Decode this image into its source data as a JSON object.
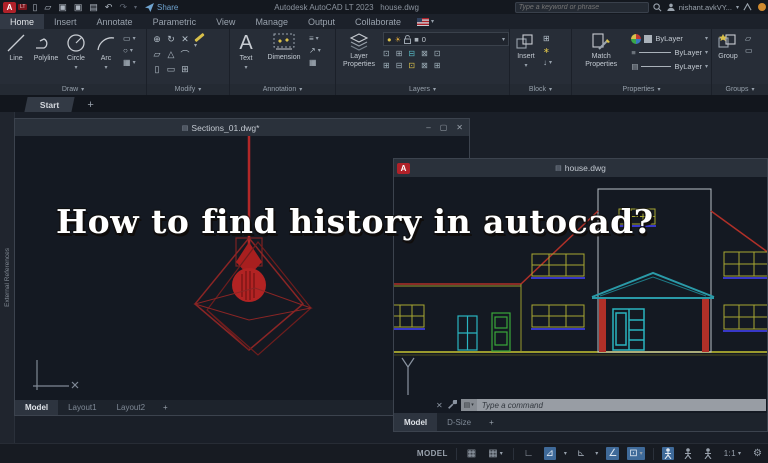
{
  "titlebar": {
    "logo_letter": "A",
    "logo_badge": "LT",
    "share_label": "Share",
    "app_title": "Autodesk AutoCAD LT 2023",
    "doc_name": "house.dwg",
    "search_placeholder": "Type a keyword or phrase",
    "account_name": "nishant.avkVY..."
  },
  "icons": {
    "new": "▯",
    "open": "▱",
    "save": "▣",
    "save_as": "▣",
    "plot": "▤",
    "undo": "↶",
    "redo": "↷",
    "caret": "▾",
    "doc": "▤",
    "grid": "▦",
    "ortho": "∟",
    "polar": "⊿",
    "isodraft": "⊾",
    "otrack": "∠",
    "osnap": "⊡",
    "gear": "⚙",
    "minimize": "–",
    "restore": "▢",
    "close": "✕",
    "plus": "+",
    "bulb": "●",
    "sun": "☀",
    "swatch": "■",
    "lines": "≡",
    "ltype": "▤",
    "text_tool": "A",
    "arrow_ne": "↗",
    "table": "▦",
    "rect": "▭",
    "ellipse": "○",
    "hatch": "▦",
    "move": "⊕",
    "rotate": "↻",
    "trim": "✕",
    "copy": "▱",
    "mirror": "△",
    "fillet": "⌒",
    "stretch": "▯",
    "scale": "▭",
    "array": "⊞",
    "blk1": "⊞",
    "blk2": "∗",
    "blk3": "↓",
    "lay1": "⊡",
    "lay2": "⊞",
    "lay3": "⊟",
    "lay4": "⊠",
    "lay5": "⊡",
    "lay6": "⊞",
    "lay7": "⊟",
    "lay8": "⊡",
    "lay9": "⊠",
    "lay10": "⊞"
  },
  "ribbon": {
    "tabs": [
      {
        "label": "Home"
      },
      {
        "label": "Insert"
      },
      {
        "label": "Annotate"
      },
      {
        "label": "Parametric"
      },
      {
        "label": "View"
      },
      {
        "label": "Manage"
      },
      {
        "label": "Output"
      },
      {
        "label": "Collaborate"
      }
    ],
    "panels": {
      "draw": {
        "label": "Draw",
        "buttons": [
          "Line",
          "Polyline",
          "Circle",
          "Arc"
        ]
      },
      "modify": {
        "label": "Modify"
      },
      "annotation": {
        "label": "Annotation",
        "text_label": "Text",
        "dimension_label": "Dimension"
      },
      "layers": {
        "label": "Layers",
        "big_label": "Layer Properties",
        "current_layer": "0"
      },
      "block": {
        "label": "Block",
        "big_label": "Insert"
      },
      "properties": {
        "label": "Properties",
        "big_label": "Match Properties",
        "color_value": "ByLayer",
        "lineweight_value": "ByLayer",
        "linetype_value": "ByLayer"
      },
      "groups": {
        "label": "Groups",
        "big_label": "Group"
      }
    }
  },
  "file_tabs": {
    "start": "Start",
    "add": "+"
  },
  "palette": {
    "label": "External References"
  },
  "overlay": {
    "text": "How to find history in autocad?"
  },
  "window_sections": {
    "title": "Sections_01.dwg*",
    "tabs": [
      {
        "label": "Model"
      },
      {
        "label": "Layout1"
      },
      {
        "label": "Layout2"
      }
    ],
    "add_tab": "+"
  },
  "window_house": {
    "title": "house.dwg",
    "command_placeholder": "Type a command",
    "tabs": [
      {
        "label": "Model"
      },
      {
        "label": "D-Size"
      }
    ],
    "add_tab": "+"
  },
  "statusbar": {
    "model_label": "MODEL",
    "scale": "1:1"
  }
}
